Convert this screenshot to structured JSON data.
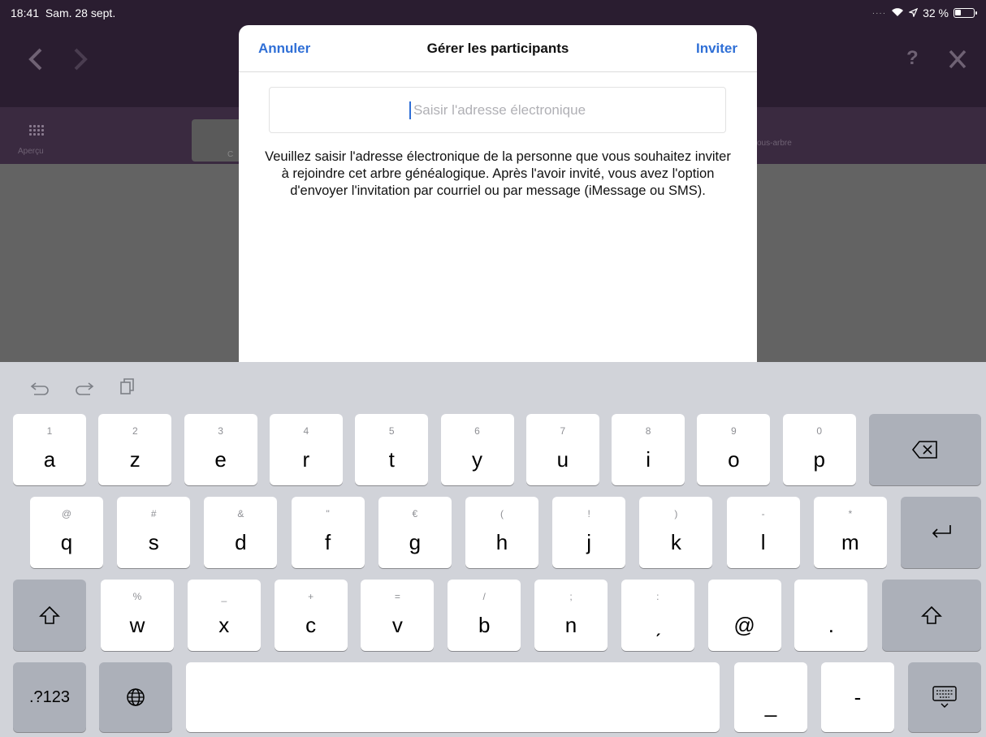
{
  "status": {
    "time": "18:41",
    "date": "Sam. 28 sept.",
    "battery_percent": "32 %",
    "battery_level": 0.32
  },
  "app": {
    "toolbar_left_label": "Aperçu",
    "toolbar_tab_label": "C",
    "toolbar_right_label": "ous-arbre"
  },
  "modal": {
    "cancel": "Annuler",
    "title": "Gérer les participants",
    "invite": "Inviter",
    "email_placeholder": "Saisir l'adresse électronique",
    "description": "Veuillez saisir l'adresse électronique de la personne que vous souhaitez inviter à rejoindre cet arbre généalogique. Après l'avoir invité, vous avez l'option d'envoyer l'invitation par courriel ou par message (iMessage ou SMS)."
  },
  "keyboard": {
    "row1": [
      {
        "hint": "1",
        "key": "a"
      },
      {
        "hint": "2",
        "key": "z"
      },
      {
        "hint": "3",
        "key": "e"
      },
      {
        "hint": "4",
        "key": "r"
      },
      {
        "hint": "5",
        "key": "t"
      },
      {
        "hint": "6",
        "key": "y"
      },
      {
        "hint": "7",
        "key": "u"
      },
      {
        "hint": "8",
        "key": "i"
      },
      {
        "hint": "9",
        "key": "o"
      },
      {
        "hint": "0",
        "key": "p"
      }
    ],
    "row2": [
      {
        "hint": "@",
        "key": "q"
      },
      {
        "hint": "#",
        "key": "s"
      },
      {
        "hint": "&",
        "key": "d"
      },
      {
        "hint": "\"",
        "key": "f"
      },
      {
        "hint": "€",
        "key": "g"
      },
      {
        "hint": "(",
        "key": "h"
      },
      {
        "hint": "!",
        "key": "j"
      },
      {
        "hint": ")",
        "key": "k"
      },
      {
        "hint": "-",
        "key": "l"
      },
      {
        "hint": "*",
        "key": "m"
      }
    ],
    "row3": [
      {
        "hint": "%",
        "key": "w"
      },
      {
        "hint": "_",
        "key": "x"
      },
      {
        "hint": "+",
        "key": "c"
      },
      {
        "hint": "=",
        "key": "v"
      },
      {
        "hint": "/",
        "key": "b"
      },
      {
        "hint": ";",
        "key": "n"
      },
      {
        "hint": ":",
        "key": "ˏ"
      },
      {
        "hint": "",
        "key": "@"
      },
      {
        "hint": "",
        "key": "."
      }
    ],
    "numbers_key": ".?123",
    "underscore_key": "_",
    "dash_key": "-"
  }
}
